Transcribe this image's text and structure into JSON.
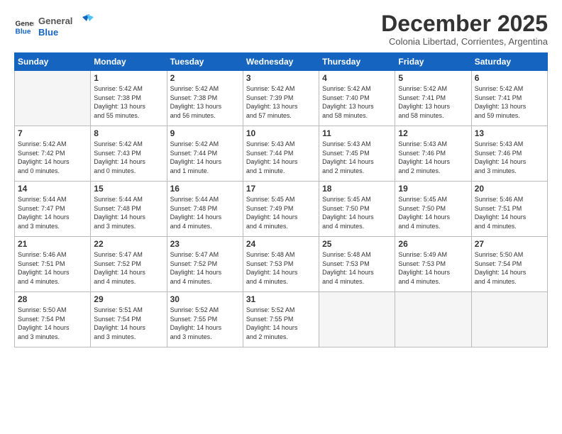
{
  "logo": {
    "general": "General",
    "blue": "Blue"
  },
  "title": "December 2025",
  "subtitle": "Colonia Libertad, Corrientes, Argentina",
  "headers": [
    "Sunday",
    "Monday",
    "Tuesday",
    "Wednesday",
    "Thursday",
    "Friday",
    "Saturday"
  ],
  "weeks": [
    [
      {
        "day": "",
        "info": ""
      },
      {
        "day": "1",
        "info": "Sunrise: 5:42 AM\nSunset: 7:38 PM\nDaylight: 13 hours\nand 55 minutes."
      },
      {
        "day": "2",
        "info": "Sunrise: 5:42 AM\nSunset: 7:38 PM\nDaylight: 13 hours\nand 56 minutes."
      },
      {
        "day": "3",
        "info": "Sunrise: 5:42 AM\nSunset: 7:39 PM\nDaylight: 13 hours\nand 57 minutes."
      },
      {
        "day": "4",
        "info": "Sunrise: 5:42 AM\nSunset: 7:40 PM\nDaylight: 13 hours\nand 58 minutes."
      },
      {
        "day": "5",
        "info": "Sunrise: 5:42 AM\nSunset: 7:41 PM\nDaylight: 13 hours\nand 58 minutes."
      },
      {
        "day": "6",
        "info": "Sunrise: 5:42 AM\nSunset: 7:41 PM\nDaylight: 13 hours\nand 59 minutes."
      }
    ],
    [
      {
        "day": "7",
        "info": "Sunrise: 5:42 AM\nSunset: 7:42 PM\nDaylight: 14 hours\nand 0 minutes."
      },
      {
        "day": "8",
        "info": "Sunrise: 5:42 AM\nSunset: 7:43 PM\nDaylight: 14 hours\nand 0 minutes."
      },
      {
        "day": "9",
        "info": "Sunrise: 5:42 AM\nSunset: 7:44 PM\nDaylight: 14 hours\nand 1 minute."
      },
      {
        "day": "10",
        "info": "Sunrise: 5:43 AM\nSunset: 7:44 PM\nDaylight: 14 hours\nand 1 minute."
      },
      {
        "day": "11",
        "info": "Sunrise: 5:43 AM\nSunset: 7:45 PM\nDaylight: 14 hours\nand 2 minutes."
      },
      {
        "day": "12",
        "info": "Sunrise: 5:43 AM\nSunset: 7:46 PM\nDaylight: 14 hours\nand 2 minutes."
      },
      {
        "day": "13",
        "info": "Sunrise: 5:43 AM\nSunset: 7:46 PM\nDaylight: 14 hours\nand 3 minutes."
      }
    ],
    [
      {
        "day": "14",
        "info": "Sunrise: 5:44 AM\nSunset: 7:47 PM\nDaylight: 14 hours\nand 3 minutes."
      },
      {
        "day": "15",
        "info": "Sunrise: 5:44 AM\nSunset: 7:48 PM\nDaylight: 14 hours\nand 3 minutes."
      },
      {
        "day": "16",
        "info": "Sunrise: 5:44 AM\nSunset: 7:48 PM\nDaylight: 14 hours\nand 4 minutes."
      },
      {
        "day": "17",
        "info": "Sunrise: 5:45 AM\nSunset: 7:49 PM\nDaylight: 14 hours\nand 4 minutes."
      },
      {
        "day": "18",
        "info": "Sunrise: 5:45 AM\nSunset: 7:50 PM\nDaylight: 14 hours\nand 4 minutes."
      },
      {
        "day": "19",
        "info": "Sunrise: 5:45 AM\nSunset: 7:50 PM\nDaylight: 14 hours\nand 4 minutes."
      },
      {
        "day": "20",
        "info": "Sunrise: 5:46 AM\nSunset: 7:51 PM\nDaylight: 14 hours\nand 4 minutes."
      }
    ],
    [
      {
        "day": "21",
        "info": "Sunrise: 5:46 AM\nSunset: 7:51 PM\nDaylight: 14 hours\nand 4 minutes."
      },
      {
        "day": "22",
        "info": "Sunrise: 5:47 AM\nSunset: 7:52 PM\nDaylight: 14 hours\nand 4 minutes."
      },
      {
        "day": "23",
        "info": "Sunrise: 5:47 AM\nSunset: 7:52 PM\nDaylight: 14 hours\nand 4 minutes."
      },
      {
        "day": "24",
        "info": "Sunrise: 5:48 AM\nSunset: 7:53 PM\nDaylight: 14 hours\nand 4 minutes."
      },
      {
        "day": "25",
        "info": "Sunrise: 5:48 AM\nSunset: 7:53 PM\nDaylight: 14 hours\nand 4 minutes."
      },
      {
        "day": "26",
        "info": "Sunrise: 5:49 AM\nSunset: 7:53 PM\nDaylight: 14 hours\nand 4 minutes."
      },
      {
        "day": "27",
        "info": "Sunrise: 5:50 AM\nSunset: 7:54 PM\nDaylight: 14 hours\nand 4 minutes."
      }
    ],
    [
      {
        "day": "28",
        "info": "Sunrise: 5:50 AM\nSunset: 7:54 PM\nDaylight: 14 hours\nand 3 minutes."
      },
      {
        "day": "29",
        "info": "Sunrise: 5:51 AM\nSunset: 7:54 PM\nDaylight: 14 hours\nand 3 minutes."
      },
      {
        "day": "30",
        "info": "Sunrise: 5:52 AM\nSunset: 7:55 PM\nDaylight: 14 hours\nand 3 minutes."
      },
      {
        "day": "31",
        "info": "Sunrise: 5:52 AM\nSunset: 7:55 PM\nDaylight: 14 hours\nand 2 minutes."
      },
      {
        "day": "",
        "info": ""
      },
      {
        "day": "",
        "info": ""
      },
      {
        "day": "",
        "info": ""
      }
    ]
  ]
}
